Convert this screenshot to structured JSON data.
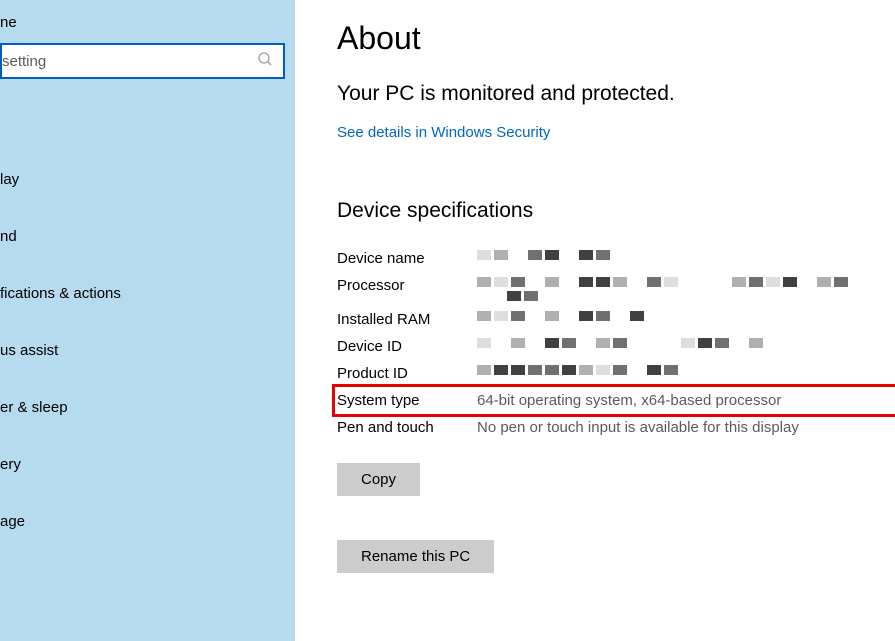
{
  "sidebar": {
    "header": "ne",
    "search_placeholder": "setting",
    "items": [
      "lay",
      "nd",
      "fications & actions",
      "us assist",
      "er & sleep",
      "ery",
      "age"
    ]
  },
  "main": {
    "title": "About",
    "status": "Your PC is monitored and protected.",
    "link": "See details in Windows Security",
    "section_title": "Device specifications",
    "specs": {
      "device_name_label": "Device name",
      "processor_label": "Processor",
      "installed_ram_label": "Installed RAM",
      "device_id_label": "Device ID",
      "product_id_label": "Product ID",
      "system_type_label": "System type",
      "system_type_value": "64-bit operating system, x64-based processor",
      "pen_touch_label": "Pen and touch",
      "pen_touch_value": "No pen or touch input is available for this display"
    },
    "copy_btn": "Copy",
    "rename_btn": "Rename this PC"
  }
}
